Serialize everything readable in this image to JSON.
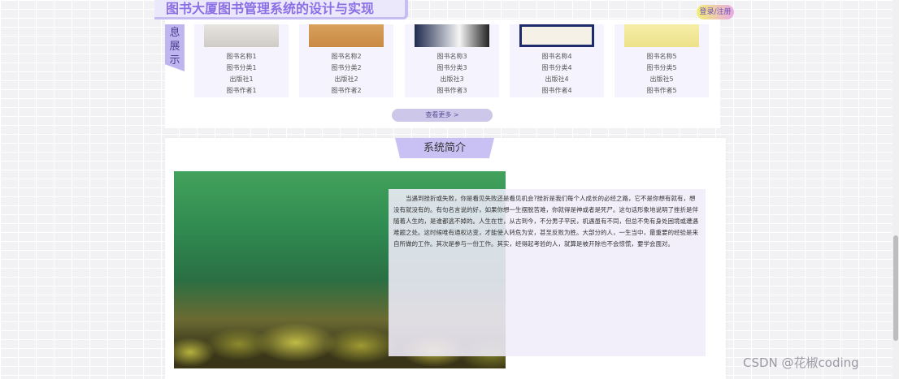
{
  "header": {
    "title": "图书大厦图书管理系统的设计与实现",
    "login_label": "登录/注册"
  },
  "books_section": {
    "side_label_chars": [
      "息",
      "展",
      "示"
    ],
    "more_button": "查看更多 >",
    "books": [
      {
        "name": "图书名称1",
        "category": "图书分类1",
        "publisher": "出版社1",
        "author": "图书作者1"
      },
      {
        "name": "图书名称2",
        "category": "图书分类2",
        "publisher": "出版社2",
        "author": "图书作者2"
      },
      {
        "name": "图书名称3",
        "category": "图书分类3",
        "publisher": "出版社3",
        "author": "图书作者3"
      },
      {
        "name": "图书名称4",
        "category": "图书分类4",
        "publisher": "出版社4",
        "author": "图书作者4"
      },
      {
        "name": "图书名称5",
        "category": "图书分类5",
        "publisher": "出版社5",
        "author": "图书作者5"
      }
    ]
  },
  "intro_section": {
    "title": "系统简介",
    "text": "当遇到挫折或失败，你是看见失败还是看见机会?挫折是我们每个人成长的必经之路，它不是你想有就有，想没有就没有的。有句名言说的好，如果你想一生摆脱苦难，你就得是神或者是死尸。这句话形象地说明了挫折是伴随着人生的，是谁都逃不掉的。人生在世，从古到今，不分男子平民，机遇虽有不同，但总不免有身处困境或遭遇难题之处。这时候唯有通权达变，才能使人转危为安，甚至反败为胜。大部分的人，一生当中，最重要的经验是来自所做的工作。其次是参与一份工作。其实，经得起考验的人，就算是被开除也不会惊慌，要学会面对。"
  },
  "watermark": "CSDN @花椒coding",
  "colors": {
    "accent_purple": "#8b6fe6",
    "tab_purple": "#c9c1f3",
    "card_bg": "#f5f3fd"
  }
}
